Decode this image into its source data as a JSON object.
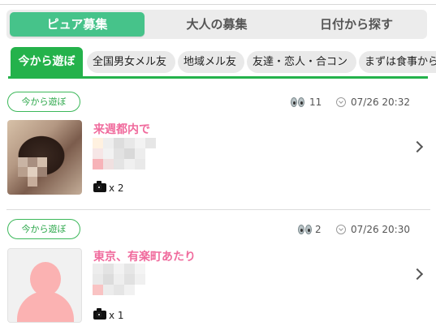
{
  "tabs": [
    {
      "label": "ピュア募集",
      "active": true
    },
    {
      "label": "大人の募集",
      "active": false
    },
    {
      "label": "日付から探す",
      "active": false
    }
  ],
  "categories": {
    "active": "今から遊ぼ",
    "items": [
      "全国男女メル友",
      "地域メル友",
      "友達・恋人・合コン",
      "まずは食事から"
    ]
  },
  "posts": [
    {
      "badge": "今から遊ぼ",
      "views": "11",
      "datetime": "07/26 20:32",
      "title": "来週都内で",
      "photo_count": "x 2",
      "thumbnail": "photo"
    },
    {
      "badge": "今から遊ぼ",
      "views": "2",
      "datetime": "07/26 20:30",
      "title": "東京、有楽町あたり",
      "photo_count": "x 1",
      "thumbnail": "avatar"
    }
  ],
  "colors": {
    "tab_active": "#46c38a",
    "category_active": "#24b24b",
    "title_pink": "#f06b9d",
    "avatar_pink": "#fbb2b2"
  },
  "icons": [
    "eyes-icon",
    "clock-icon",
    "camera-icon",
    "chevron-right-icon"
  ]
}
